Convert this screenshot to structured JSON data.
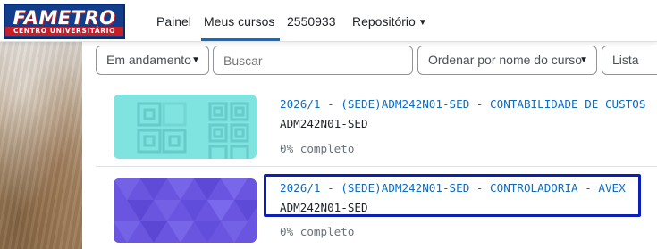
{
  "brand": {
    "logo_text": "FAMETRO",
    "logo_subtext": "CENTRO UNIVERSITÁRIO",
    "primary_color": "#123d8a",
    "accent_color": "#c81e28"
  },
  "nav": {
    "items": [
      {
        "label": "Painel"
      },
      {
        "label": "Meus cursos",
        "active": true
      },
      {
        "label": "2550933"
      },
      {
        "label": "Repositório",
        "has_dropdown": true
      }
    ]
  },
  "filters": {
    "grouping": "Em andamento",
    "search_placeholder": "Buscar",
    "sort": "Ordenar por nome do curso",
    "view": "Lista"
  },
  "courses": [
    {
      "title": "2026/1 - (SEDE)ADM242N01-SED - CONTABILIDADE DE CUSTOS",
      "short_name": "ADM242N01-SED",
      "progress_text": "0% completo",
      "progress": 0,
      "image_pattern": "teal-squares",
      "image_color": "#7fe3e0"
    },
    {
      "title": "2026/1 - (SEDE)ADM242N01-SED - CONTROLADORIA - AVEX",
      "short_name": "ADM242N01-SED",
      "progress_text": "0% completo",
      "progress": 0,
      "image_pattern": "purple-triangles",
      "image_color": "#6a55e0",
      "highlighted": true
    }
  ],
  "link_color": "#0f6cbf"
}
